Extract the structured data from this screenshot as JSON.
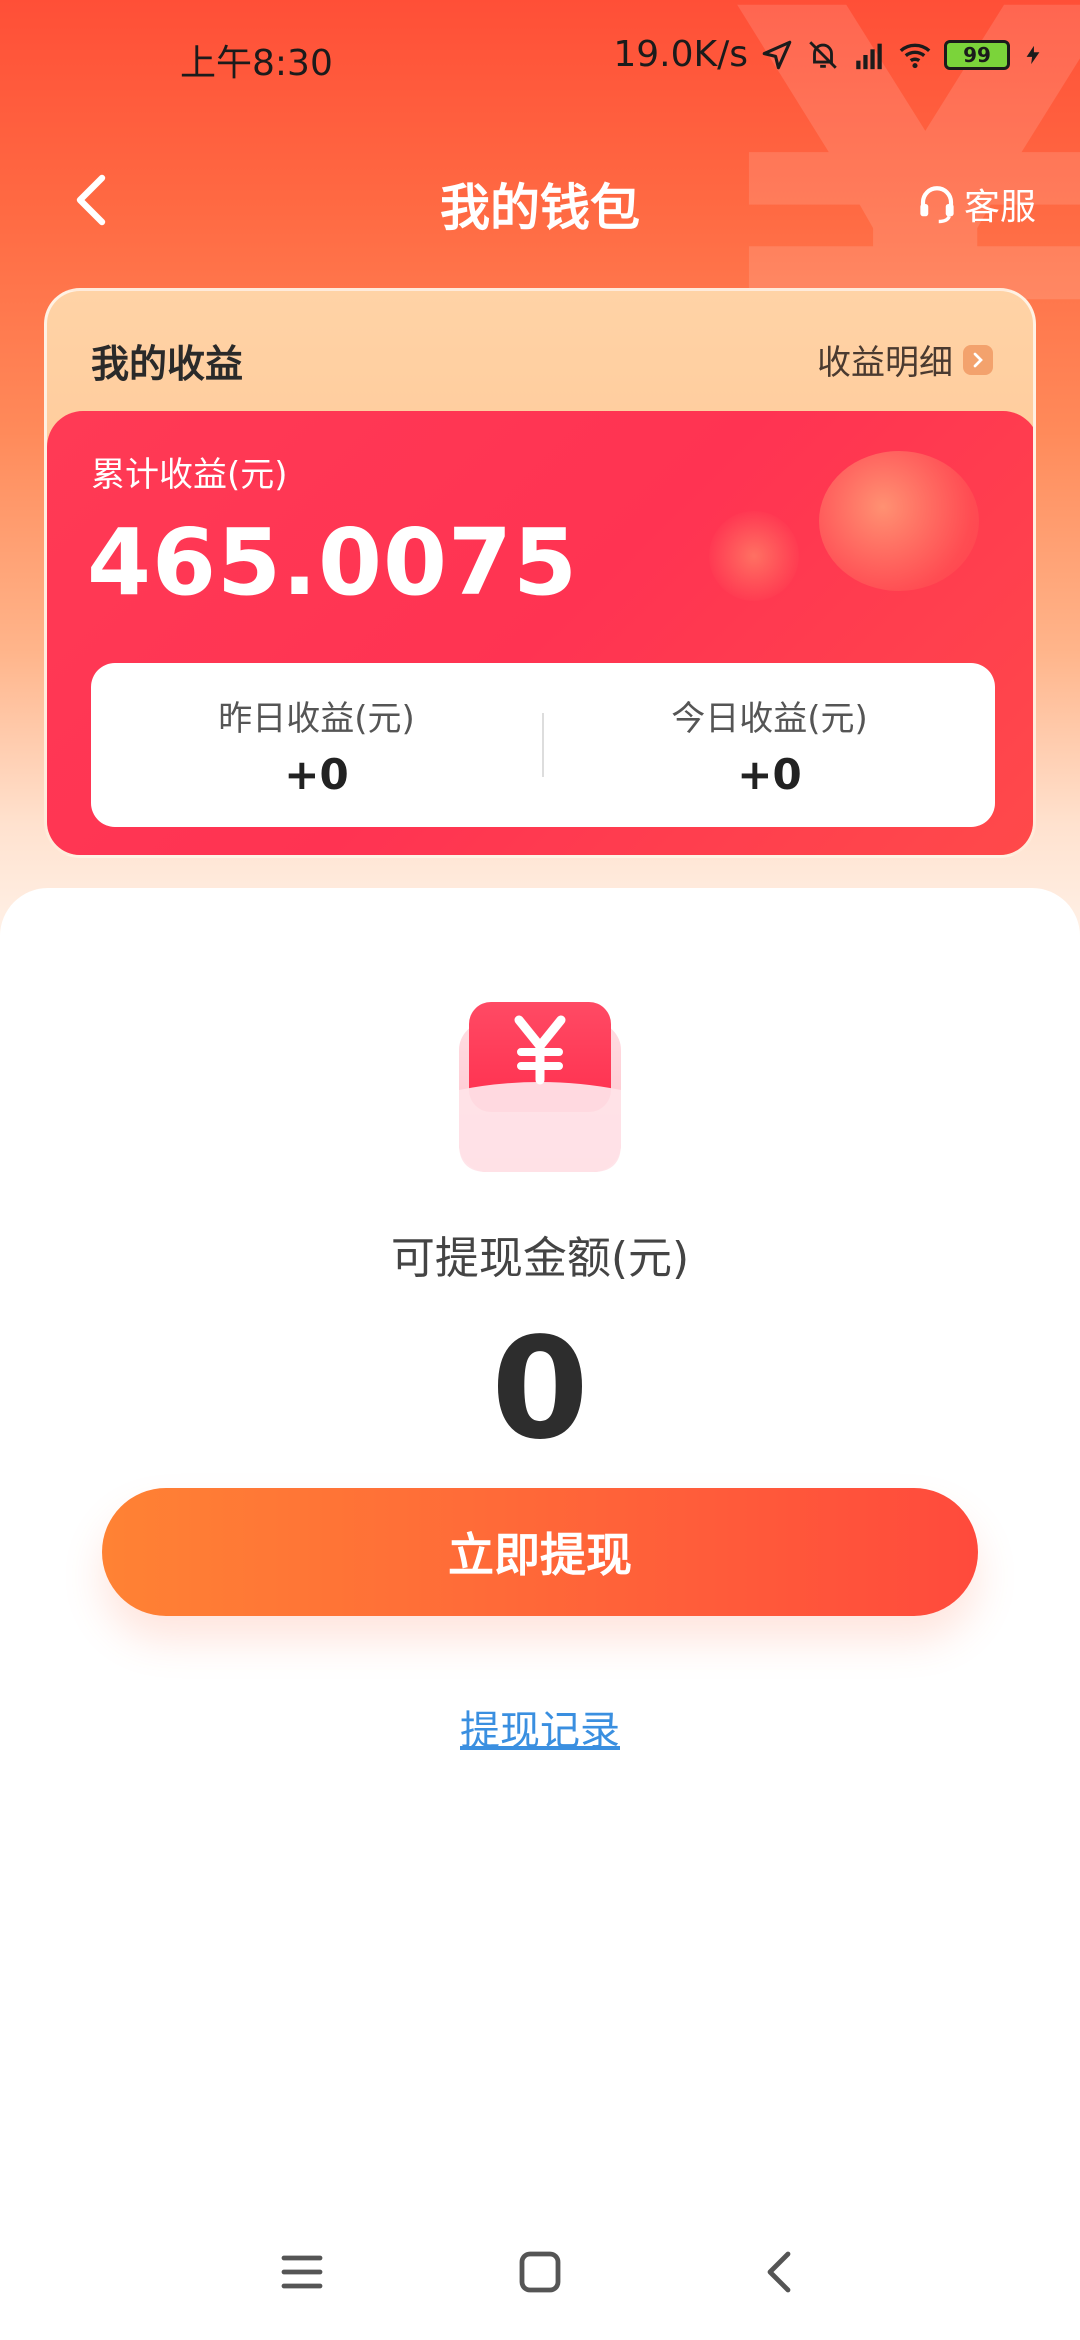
{
  "status_bar": {
    "time": "上午8:30",
    "net_speed": "19.0K/s",
    "battery": "99",
    "icons": [
      "location-icon",
      "mute-icon",
      "signal-icon",
      "wifi-icon",
      "battery-icon",
      "charging-icon"
    ]
  },
  "nav": {
    "title": "我的钱包",
    "service_label": "客服"
  },
  "earnings": {
    "title": "我的收益",
    "detail_link": "收益明细",
    "total_label": "累计收益(元)",
    "total_value": "465.0075",
    "yesterday_label": "昨日收益(元)",
    "yesterday_value": "+0",
    "today_label": "今日收益(元)",
    "today_value": "+0"
  },
  "withdraw": {
    "label": "可提现金额(元)",
    "amount": "0",
    "button": "立即提现",
    "record_link": "提现记录"
  },
  "colors": {
    "header_red": "#ff4f37",
    "card_red": "#ff3a55",
    "button_orange": "#ff8234",
    "link_blue": "#3a8fe0"
  }
}
